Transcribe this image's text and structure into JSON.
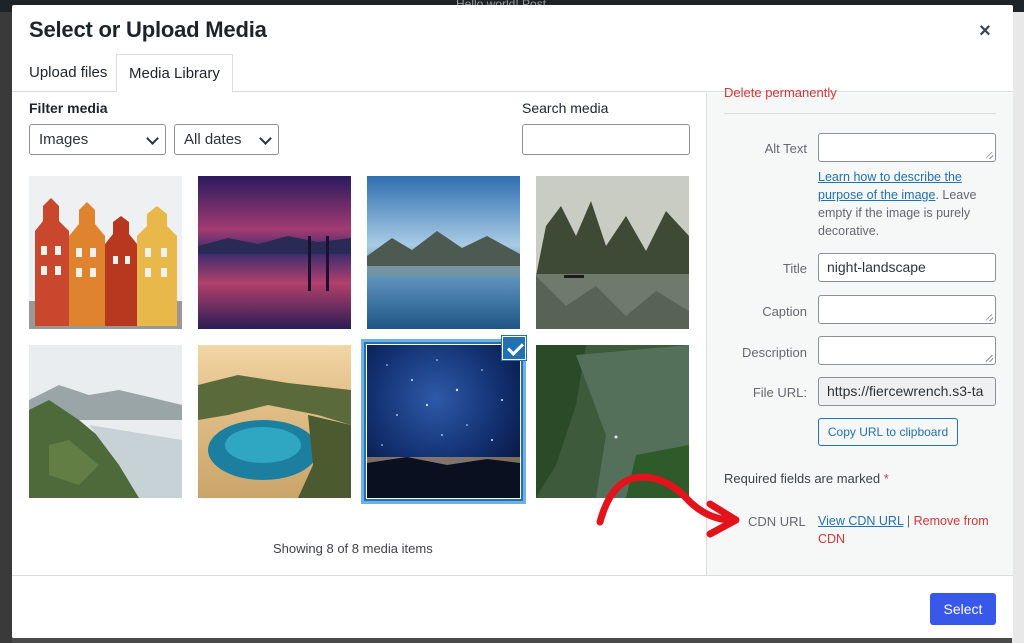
{
  "backdrop": {
    "text": "Hello world!   Post"
  },
  "modal": {
    "title": "Select or Upload Media",
    "close": "×"
  },
  "tabs": [
    {
      "label": "Upload files"
    },
    {
      "label": "Media Library"
    }
  ],
  "filters": {
    "label": "Filter media",
    "type_value": "Images",
    "date_value": "All dates",
    "search_label": "Search media",
    "search_value": ""
  },
  "media": {
    "items": [
      "houses",
      "sunset-lake",
      "mountain-lake",
      "boat-karst",
      "coast-cliffs",
      "lagoon",
      "night-landscape",
      "forest-river"
    ],
    "selected": "night-landscape",
    "showing": "Showing 8 of 8 media items"
  },
  "sidebar": {
    "delete_link": "Delete permanently",
    "alt_label": "Alt Text",
    "alt_value": "",
    "help_link": "Learn how to describe the purpose of the image",
    "help_rest": ". Leave empty if the image is purely decorative.",
    "title_label": "Title",
    "title_value": "night-landscape",
    "caption_label": "Caption",
    "caption_value": "",
    "description_label": "Description",
    "description_value": "",
    "fileurl_label": "File URL:",
    "fileurl_value": "https://fiercewrench.s3-ta",
    "copy_button": "Copy URL to clipboard",
    "required_text": "Required fields are marked",
    "required_star": "*",
    "cdn_label": "CDN URL",
    "cdn_view": "View CDN URL",
    "cdn_sep": " | ",
    "cdn_remove": "Remove from CDN"
  },
  "footer": {
    "select_button": "Select"
  },
  "colors": {
    "accent": "#3858e9",
    "link": "#2271b1",
    "danger": "#d63638",
    "annotation": "#e3131b"
  }
}
